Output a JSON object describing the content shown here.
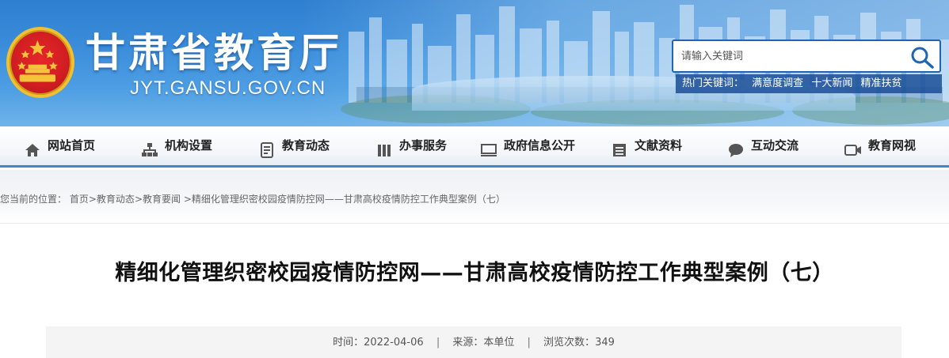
{
  "header": {
    "site_name": "甘肃省教育厅",
    "site_domain": "JYT.GANSU.GOV.CN",
    "emblem_icon": "national-emblem-icon"
  },
  "search": {
    "placeholder": "请输入关键词",
    "hot_label": "热门关键词：",
    "hot_keywords": [
      "满意度调查",
      "十大新闻",
      "精准扶贫"
    ],
    "icon": "search-icon"
  },
  "nav": {
    "items": [
      {
        "label": "网站首页",
        "icon": "home-icon"
      },
      {
        "label": "机构设置",
        "icon": "org-chart-icon"
      },
      {
        "label": "教育动态",
        "icon": "document-icon"
      },
      {
        "label": "办事服务",
        "icon": "briefcase-icon"
      },
      {
        "label": "政府信息公开",
        "icon": "monitor-icon"
      },
      {
        "label": "文献资料",
        "icon": "archive-icon"
      },
      {
        "label": "互动交流",
        "icon": "chat-icon"
      },
      {
        "label": "教育网视",
        "icon": "video-icon"
      }
    ]
  },
  "breadcrumb": {
    "prefix": "您当前的位置：",
    "items": [
      "首页",
      "教育动态",
      "教育要闻",
      "精细化管理织密校园疫情防控网——甘肃高校疫情防控工作典型案例（七）"
    ],
    "separator": ">"
  },
  "article": {
    "title": "精细化管理织密校园疫情防控网——甘肃高校疫情防控工作典型案例（七）",
    "meta": {
      "time_label": "时间：",
      "time": "2022-04-06",
      "source_label": "来源：",
      "source": "本单位",
      "views_label": "浏览次数：",
      "views": "349",
      "separator": "|"
    }
  },
  "colors": {
    "banner_blue": "#3a8cda",
    "nav_border": "#3e86cf",
    "search_border": "#1e66b4",
    "hot_bar": "#1a4e96",
    "emblem_red": "#d11e22",
    "emblem_gold": "#f2c02e"
  }
}
